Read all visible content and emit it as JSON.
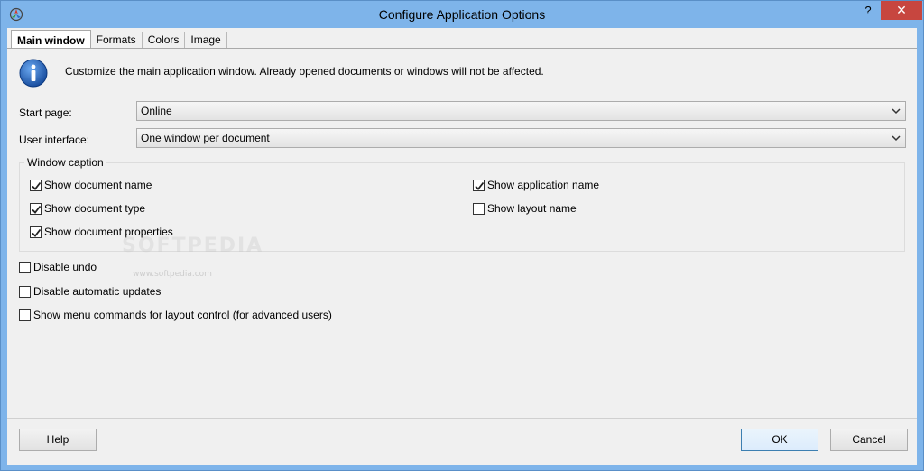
{
  "window": {
    "title": "Configure Application Options",
    "help_glyph": "?",
    "close_glyph": "✕",
    "icon": "app-logo-icon"
  },
  "tabs": [
    {
      "label": "Main window",
      "active": true
    },
    {
      "label": "Formats",
      "active": false
    },
    {
      "label": "Colors",
      "active": false
    },
    {
      "label": "Image",
      "active": false
    }
  ],
  "info": {
    "icon": "info-icon",
    "text": "Customize the main application window. Already opened documents or windows will not be affected."
  },
  "start_page": {
    "label": "Start page:",
    "value": "Online"
  },
  "user_interface": {
    "label": "User interface:",
    "value": "One window per document"
  },
  "window_caption": {
    "title": "Window caption",
    "options": [
      {
        "label": "Show document name",
        "checked": true
      },
      {
        "label": "Show document type",
        "checked": true
      },
      {
        "label": "Show document properties",
        "checked": true
      },
      {
        "label": "Show application name",
        "checked": true
      },
      {
        "label": "Show layout name",
        "checked": false
      }
    ]
  },
  "options": [
    {
      "label": "Disable undo",
      "checked": false
    },
    {
      "label": "Disable automatic updates",
      "checked": false
    },
    {
      "label": "Show menu commands for layout control (for advanced users)",
      "checked": false
    }
  ],
  "watermark": {
    "text": "SOFTPEDIA",
    "sub": "www.softpedia.com"
  },
  "buttons": {
    "help": "Help",
    "ok": "OK",
    "cancel": "Cancel"
  },
  "colors": {
    "title_bar": "#7eb4ea",
    "close_button": "#c7463f",
    "dialog_bg": "#f0f0f0",
    "info_icon_blue": "#1a5fb4"
  }
}
